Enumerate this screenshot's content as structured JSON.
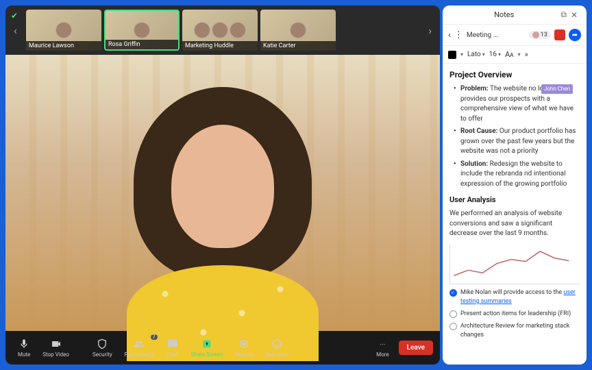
{
  "gallery": {
    "thumbs": [
      {
        "label": "Maurice Lawson"
      },
      {
        "label": "Rosa Griffin"
      },
      {
        "label": "Marketing Huddle"
      },
      {
        "label": "Katie Carter"
      }
    ]
  },
  "toolbar": {
    "mute": "Mute",
    "stop_video": "Stop Video",
    "security": "Security",
    "participants": "Participants",
    "participants_count": "7",
    "chat": "Chat",
    "share": "Share Screen",
    "record": "Record",
    "reactions": "Reactions",
    "more": "More",
    "leave": "Leave"
  },
  "notes": {
    "title": "Notes",
    "meeting": "Meeting ...",
    "participant_count": "13",
    "format": {
      "font": "Lato",
      "size": "16"
    },
    "h1": "Project Overview",
    "problem_label": "Problem:",
    "problem_text": " The website no longer provides our prospects with a comprehensive view of what we have to offer",
    "collab_user": "John Chen",
    "root_label": "Root Cause:",
    "root_text": " Our product portfolio has grown over the past few years but the website was not a priority",
    "solution_label": "Solution:",
    "solution_text": " Redesign the website to include the rebranda nd intentional expression of the growing portfolio",
    "h2": "User Analysis",
    "analysis_text": "We performed an analysis of website conversions and saw a significant decrease over the last 9 months.",
    "task1_pre": "Mike Nolan will provide access to the ",
    "task1_link": "user testing summaries",
    "task2": "Present action items for leadership (FRI)",
    "task3": "Architecture Review for marketing stack changes"
  },
  "chart_data": {
    "type": "line",
    "x": [
      1,
      2,
      3,
      4,
      5,
      6,
      7,
      8,
      9
    ],
    "values": [
      20,
      35,
      28,
      48,
      55,
      50,
      72,
      60,
      55
    ],
    "ylim": [
      0,
      80
    ]
  }
}
